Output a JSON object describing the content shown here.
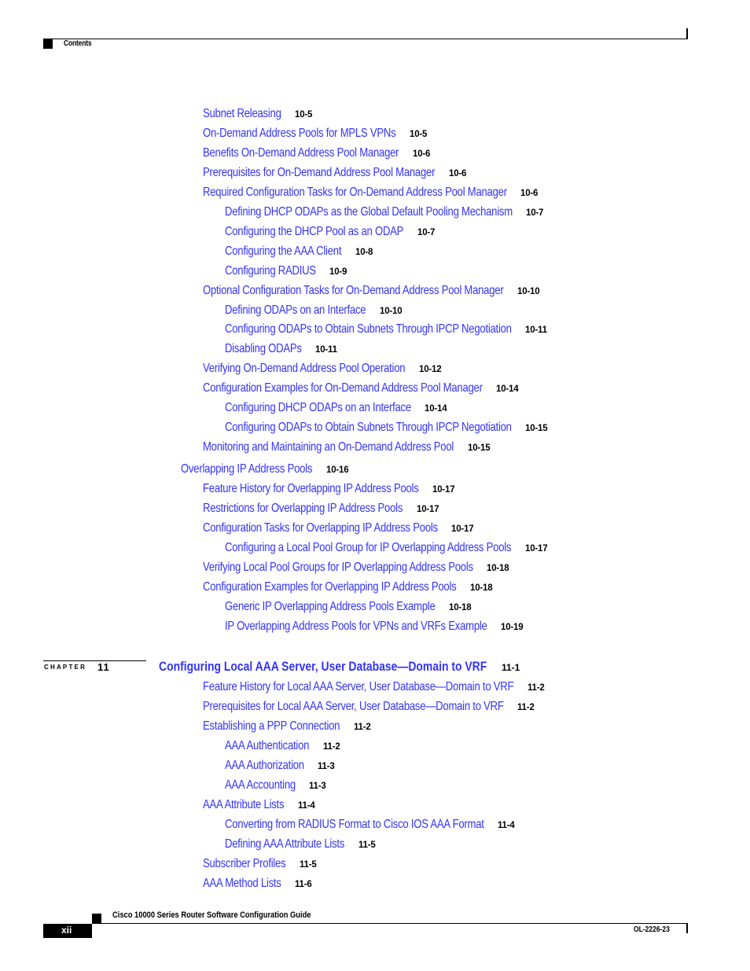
{
  "header": {
    "section_label": "Contents"
  },
  "toc_part1": [
    {
      "level": 2,
      "title": "Subnet Releasing",
      "page": "10-5"
    },
    {
      "level": 2,
      "title": "On-Demand Address Pools for MPLS VPNs",
      "page": "10-5"
    },
    {
      "level": 2,
      "title": "Benefits On-Demand Address Pool Manager",
      "page": "10-6"
    },
    {
      "level": 2,
      "title": "Prerequisites for On-Demand Address Pool Manager",
      "page": "10-6"
    },
    {
      "level": 2,
      "title": "Required Configuration Tasks for On-Demand Address Pool Manager",
      "page": "10-6"
    },
    {
      "level": 3,
      "title": "Defining DHCP ODAPs as the Global Default Pooling Mechanism",
      "page": "10-7"
    },
    {
      "level": 3,
      "title": "Configuring the DHCP Pool as an ODAP",
      "page": "10-7"
    },
    {
      "level": 3,
      "title": "Configuring the AAA Client",
      "page": "10-8"
    },
    {
      "level": 3,
      "title": "Configuring RADIUS",
      "page": "10-9"
    },
    {
      "level": 2,
      "title": "Optional Configuration Tasks for On-Demand Address Pool Manager",
      "page": "10-10"
    },
    {
      "level": 3,
      "title": "Defining ODAPs on an Interface",
      "page": "10-10"
    },
    {
      "level": 3,
      "title": "Configuring ODAPs to Obtain Subnets Through IPCP Negotiation",
      "page": "10-11"
    },
    {
      "level": 3,
      "title": "Disabling ODAPs",
      "page": "10-11"
    },
    {
      "level": 2,
      "title": "Verifying On-Demand Address Pool Operation",
      "page": "10-12"
    },
    {
      "level": 2,
      "title": "Configuration Examples for On-Demand Address Pool Manager",
      "page": "10-14"
    },
    {
      "level": 3,
      "title": "Configuring DHCP ODAPs on an Interface",
      "page": "10-14"
    },
    {
      "level": 3,
      "title": "Configuring ODAPs to Obtain Subnets Through IPCP Negotiation",
      "page": "10-15"
    },
    {
      "level": 2,
      "title": "Monitoring and Maintaining an On-Demand Address Pool",
      "page": "10-15"
    }
  ],
  "toc_part2": [
    {
      "level": 1,
      "title": "Overlapping IP Address Pools",
      "page": "10-16"
    },
    {
      "level": 2,
      "title": "Feature History for Overlapping IP Address Pools",
      "page": "10-17"
    },
    {
      "level": 2,
      "title": "Restrictions for Overlapping IP Address Pools",
      "page": "10-17"
    },
    {
      "level": 2,
      "title": "Configuration Tasks for Overlapping IP Address Pools",
      "page": "10-17"
    },
    {
      "level": 3,
      "title": "Configuring a Local Pool Group for IP Overlapping Address Pools",
      "page": "10-17"
    },
    {
      "level": 2,
      "title": "Verifying Local Pool Groups for IP Overlapping Address Pools",
      "page": "10-18"
    },
    {
      "level": 2,
      "title": "Configuration Examples for Overlapping IP Address Pools",
      "page": "10-18"
    },
    {
      "level": 3,
      "title": "Generic IP Overlapping Address Pools Example",
      "page": "10-18"
    },
    {
      "level": 3,
      "title": "IP Overlapping Address Pools for VPNs and VRFs Example",
      "page": "10-19"
    }
  ],
  "chapter": {
    "label": "CHAPTER",
    "number": "11",
    "title": "Configuring Local AAA Server, User Database—Domain to VRF",
    "page": "11-1"
  },
  "toc_part3": [
    {
      "level": 2,
      "title": "Feature History for Local AAA Server, User Database—Domain to VRF",
      "page": "11-2"
    },
    {
      "level": 2,
      "title": "Prerequisites for Local AAA Server, User Database—Domain to VRF",
      "page": "11-2"
    },
    {
      "level": 2,
      "title": "Establishing a PPP Connection",
      "page": "11-2"
    },
    {
      "level": 3,
      "title": "AAA Authentication",
      "page": "11-2"
    },
    {
      "level": 3,
      "title": "AAA Authorization",
      "page": "11-3"
    },
    {
      "level": 3,
      "title": "AAA Accounting",
      "page": "11-3"
    },
    {
      "level": 2,
      "title": "AAA Attribute Lists",
      "page": "11-4"
    },
    {
      "level": 3,
      "title": "Converting from RADIUS Format to Cisco IOS AAA Format",
      "page": "11-4"
    },
    {
      "level": 3,
      "title": "Defining AAA Attribute Lists",
      "page": "11-5"
    },
    {
      "level": 2,
      "title": "Subscriber Profiles",
      "page": "11-5"
    },
    {
      "level": 2,
      "title": "AAA Method Lists",
      "page": "11-6"
    }
  ],
  "footer": {
    "book_title": "Cisco 10000 Series Router Software Configuration Guide",
    "page_number": "xii",
    "doc_number": "OL-2226-23"
  },
  "colors": {
    "link": "#3333ff",
    "text": "#000000"
  }
}
